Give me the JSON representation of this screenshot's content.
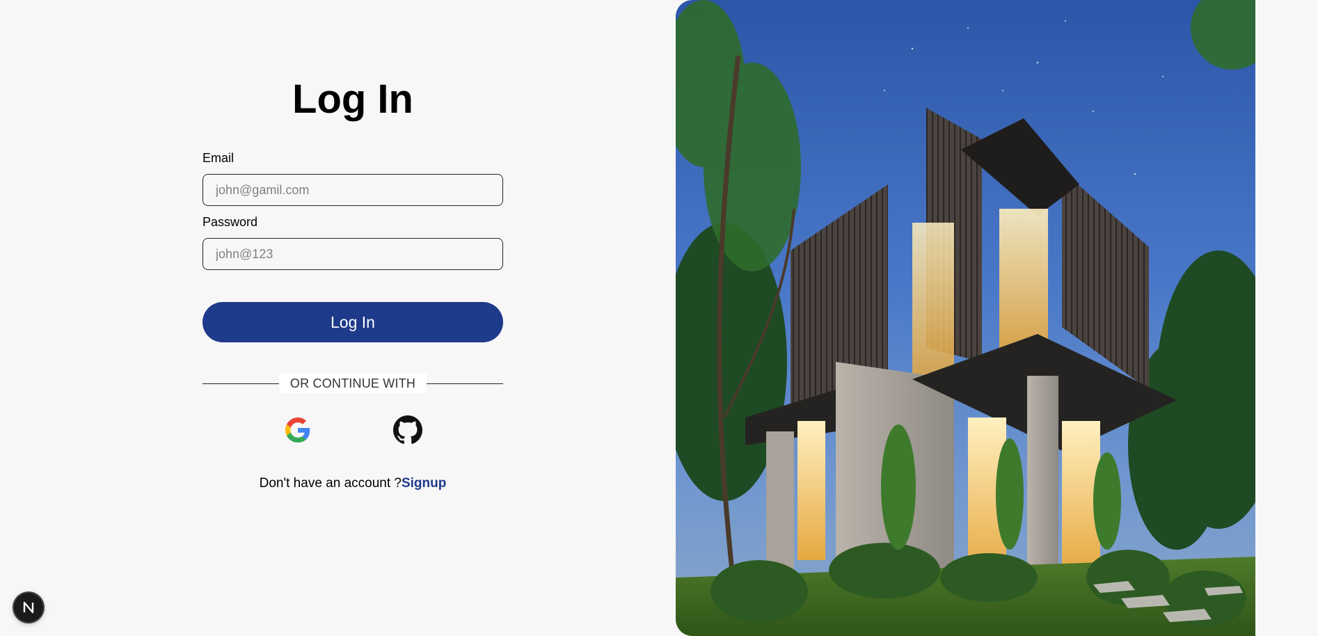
{
  "login": {
    "title": "Log In",
    "email_label": "Email",
    "email_placeholder": "john@gamil.com",
    "password_label": "Password",
    "password_placeholder": "john@123",
    "submit_label": "Log In",
    "divider_text": "OR CONTINUE WITH",
    "social": [
      {
        "name": "google",
        "icon": "google-icon"
      },
      {
        "name": "github",
        "icon": "github-icon"
      }
    ],
    "signup_prompt": "Don't have an account ?",
    "signup_link": "Signup"
  },
  "hero_image": {
    "description_icon": "modern-house-photo"
  },
  "dev_badge": {
    "icon": "nextjs-icon",
    "letter": "N"
  },
  "colors": {
    "page_background": "#f7f7f7",
    "primary_button": "#1e3a8a",
    "signup_link": "#1e3a8a",
    "badge_background": "#1a1a1a"
  }
}
